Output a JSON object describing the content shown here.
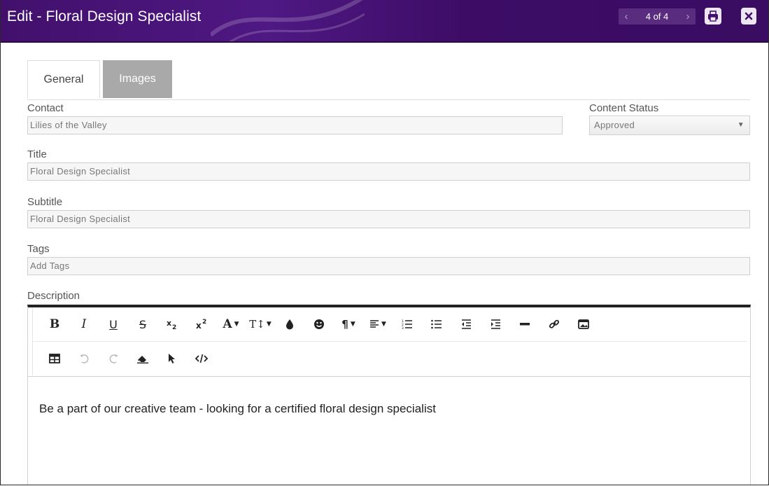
{
  "header": {
    "title": "Edit - Floral Design Specialist",
    "pager": {
      "text": "4 of 4",
      "prev": "‹",
      "next": "›"
    }
  },
  "tabs": [
    {
      "label": "General"
    },
    {
      "label": "Images"
    }
  ],
  "form": {
    "contact": {
      "label": "Contact",
      "value": "Lilies of the Valley"
    },
    "content_status": {
      "label": "Content Status",
      "value": "Approved"
    },
    "title": {
      "label": "Title",
      "value": "Floral Design Specialist"
    },
    "subtitle": {
      "label": "Subtitle",
      "value": "Floral Design Specialist"
    },
    "tags": {
      "label": "Tags",
      "placeholder": "Add Tags"
    },
    "description": {
      "label": "Description",
      "value": "Be a part of our creative team - looking for a certified floral design specialist"
    }
  },
  "toolbar_text": {
    "bold": "B",
    "italic": "I",
    "underline": "U",
    "strike": "S",
    "font_color": "A",
    "font_size": "T↕"
  },
  "colors": {
    "header": "#42106c",
    "tab_inactive": "#a9a9a9"
  },
  "icons": [
    "print-icon",
    "close-icon",
    "bold-icon",
    "italic-icon",
    "underline-icon",
    "strikethrough-icon",
    "subscript-icon",
    "superscript-icon",
    "font-color-icon",
    "font-size-icon",
    "color-drop-icon",
    "emoji-icon",
    "paragraph-icon",
    "align-icon",
    "ordered-list-icon",
    "unordered-list-icon",
    "outdent-icon",
    "indent-icon",
    "horizontal-rule-icon",
    "link-icon",
    "image-icon",
    "table-icon",
    "undo-icon",
    "redo-icon",
    "clear-format-icon",
    "select-all-icon",
    "code-view-icon"
  ]
}
